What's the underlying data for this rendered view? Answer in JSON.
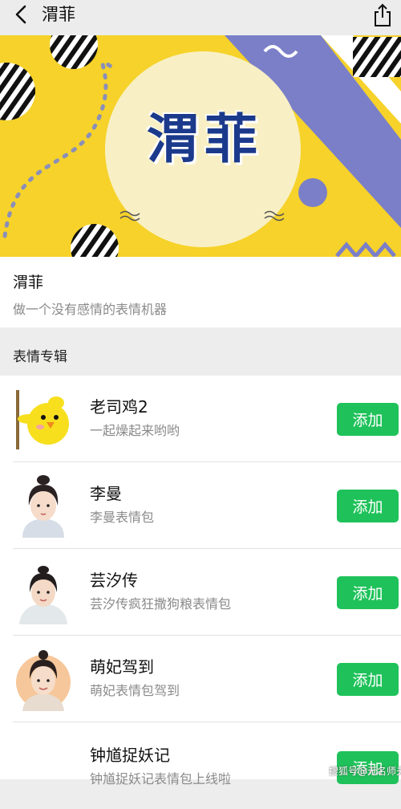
{
  "header": {
    "title": "渭菲"
  },
  "banner": {
    "art_text": "渭菲"
  },
  "profile": {
    "name": "渭菲",
    "description": "做一个没有感情的表情机器"
  },
  "section": {
    "title": "表情专辑"
  },
  "albums": [
    {
      "title": "老司鸡2",
      "subtitle": "一起燥起来哟哟",
      "action": "添加"
    },
    {
      "title": "李曼",
      "subtitle": "李曼表情包",
      "action": "添加"
    },
    {
      "title": "芸汐传",
      "subtitle": "芸汐传疯狂撒狗粮表情包",
      "action": "添加"
    },
    {
      "title": "萌妃驾到",
      "subtitle": "萌妃表情包驾到",
      "action": "添加"
    },
    {
      "title": "钟馗捉妖记",
      "subtitle": "钟馗捉妖记表情包上线啦",
      "action": "添加"
    }
  ],
  "watermark": "搜狐号@无名师夫",
  "colors": {
    "accent_green": "#1fc25a",
    "banner_yellow": "#f6d22a",
    "banner_purple": "#7b7fc8"
  },
  "icons": {
    "back": "chevron-left-icon",
    "share": "share-icon"
  }
}
